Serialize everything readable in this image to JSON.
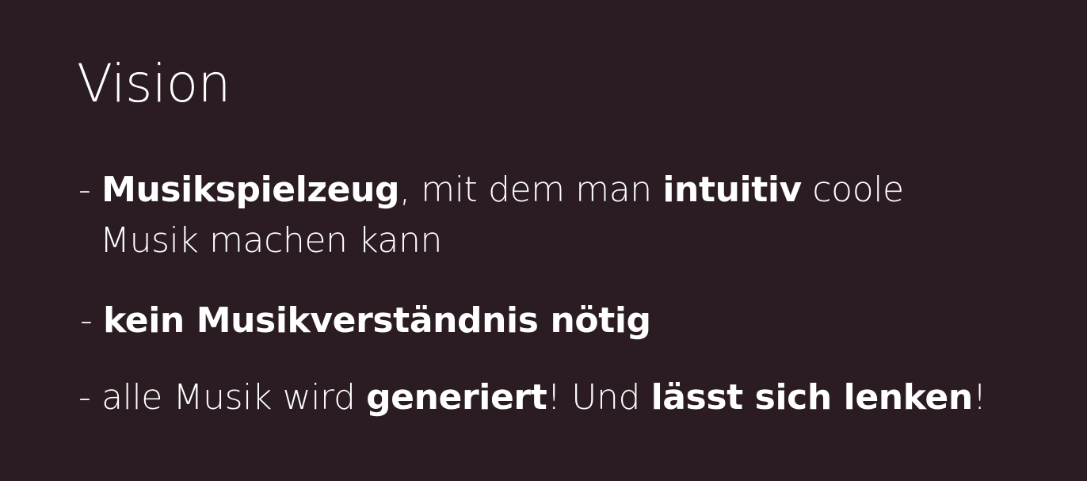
{
  "slide": {
    "title": "Vision",
    "bullets": [
      {
        "dash": "- ",
        "strong1": "Musikspielzeug",
        "text1": ", mit dem man ",
        "strong2": "intuitiv",
        "text2": " coole",
        "line2": "Musik machen kann"
      },
      {
        "dash": "- ",
        "strong1": "kein Musikverständnis nötig"
      },
      {
        "dash": "- ",
        "text1": "alle Musik wird ",
        "strong1": "generiert",
        "text2": "! Und ",
        "strong2": "lässt sich lenken",
        "text3": "!"
      }
    ]
  },
  "colors": {
    "background": "#2a1c22",
    "text": "#ffffff"
  }
}
